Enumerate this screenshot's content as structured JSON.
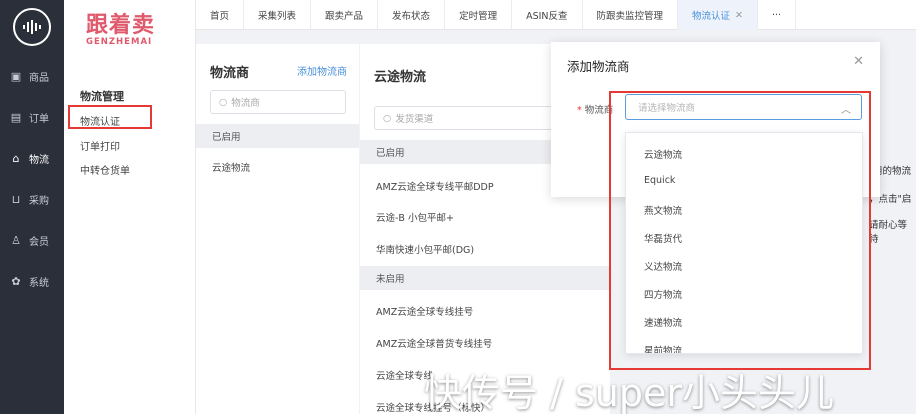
{
  "nav": {
    "items": [
      {
        "icon": "shop-icon",
        "label": "商品"
      },
      {
        "icon": "order-icon",
        "label": "订单"
      },
      {
        "icon": "logistics-icon",
        "label": "物流"
      },
      {
        "icon": "cart-icon",
        "label": "采购"
      },
      {
        "icon": "user-icon",
        "label": "会员"
      },
      {
        "icon": "system-icon",
        "label": "系统"
      }
    ]
  },
  "brand": {
    "cn": "跟着卖",
    "en": "GENZHEMAI"
  },
  "submenu": {
    "title": "物流管理",
    "items": [
      "物流认证",
      "订单打印",
      "中转仓货单"
    ]
  },
  "tabs": [
    "首页",
    "采集列表",
    "跟卖产品",
    "发布状态",
    "定时管理",
    "ASIN反查",
    "防跟卖监控管理",
    "物流认证",
    "···"
  ],
  "panel_carriers": {
    "title": "物流商",
    "add_link": "添加物流商",
    "search_placeholder": "物流商",
    "group_enabled": "已启用",
    "items": [
      "云途物流"
    ]
  },
  "panel_channels": {
    "title": "云途物流",
    "search_placeholder": "发货渠道",
    "group_enabled": "已启用",
    "enabled_items": [
      "AMZ云途全球专线平邮DDP",
      "云途-B 小包平邮+",
      "华南快速小包平邮(DG)"
    ],
    "group_disabled": "未启用",
    "disabled_items": [
      "AMZ云途全球专线挂号",
      "AMZ云途全球普货专线挂号",
      "云途全球专线",
      "云途全球专线挂号（标快）"
    ]
  },
  "right_partial": [
    "用的物流",
    "，点击\"启",
    "请耐心等待"
  ],
  "modal": {
    "title": "添加物流商",
    "label": "物流商",
    "required_mark": "*",
    "placeholder": "请选择物流商"
  },
  "dropdown_options": [
    "云途物流",
    "Equick",
    "燕文物流",
    "华磊货代",
    "义达物流",
    "四方物流",
    "速递物流",
    "星前物流"
  ],
  "watermark": "快传号 / super小头头儿",
  "colors": {
    "nav_bg": "#2b2f3a",
    "accent": "#4a90d9",
    "brand": "#e05a6d",
    "highlight": "#e53935"
  }
}
